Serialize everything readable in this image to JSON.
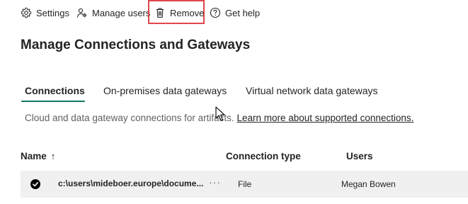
{
  "toolbar": {
    "settings_label": "Settings",
    "manage_users_label": "Manage users",
    "remove_label": "Remove",
    "get_help_label": "Get help"
  },
  "page_title": "Manage Connections and Gateways",
  "tabs": [
    {
      "label": "Connections",
      "selected": true
    },
    {
      "label": "On-premises data gateways",
      "selected": false
    },
    {
      "label": "Virtual network data gateways",
      "selected": false
    }
  ],
  "description": {
    "text": "Cloud and data gateway connections for artifacts.",
    "link": "Learn more about supported connections."
  },
  "table": {
    "columns": {
      "name": "Name",
      "name_sort": "↑",
      "type": "Connection type",
      "users": "Users"
    },
    "rows": [
      {
        "name": "c:\\users\\mideboer.europe\\docume...",
        "more": "···",
        "type": "File",
        "users": "Megan Bowen",
        "selected": true
      }
    ]
  },
  "colors": {
    "accent": "#117865",
    "highlight": "#e0474c",
    "row_bg": "#f0f0f0"
  }
}
